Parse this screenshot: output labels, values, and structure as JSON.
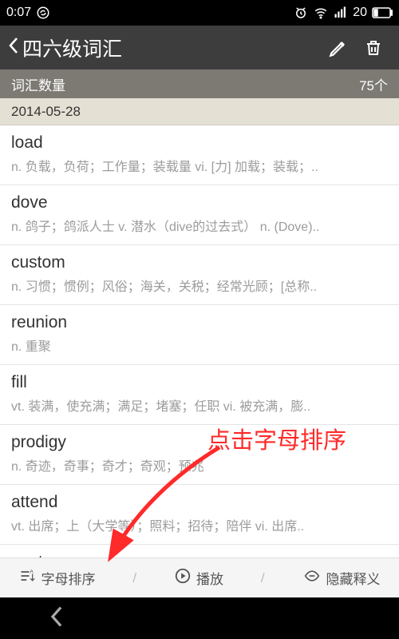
{
  "status": {
    "time": "0:07",
    "battery": "20"
  },
  "header": {
    "title": "四六级词汇"
  },
  "count_row": {
    "label": "词汇数量",
    "value": "75个"
  },
  "date_section": "2014-05-28",
  "words": [
    {
      "word": "load",
      "def": "n. 负载，负荷；工作量；装载量 vi. [力] 加载；装载；.."
    },
    {
      "word": "dove",
      "def": "n. 鸽子；鸽派人士 v. 潜水（dive的过去式） n. (Dove).."
    },
    {
      "word": "custom",
      "def": "n. 习惯；惯例；风俗；海关，关税；经常光顾；[总称.."
    },
    {
      "word": "reunion",
      "def": "n. 重聚"
    },
    {
      "word": "fill",
      "def": "vt. 装满，使充满；满足；堵塞；任职 vi. 被充满，膨.."
    },
    {
      "word": "prodigy",
      "def": "n. 奇迹，奇事；奇才；奇观；预兆"
    },
    {
      "word": "attend",
      "def": "vt. 出席；上（大学等）；照料；招待；陪伴 vi. 出席.."
    },
    {
      "word": "spot",
      "def": ""
    }
  ],
  "toolbar": {
    "sort": "字母排序",
    "play": "播放",
    "hide": "隐藏释义"
  },
  "annotation": "点击字母排序"
}
